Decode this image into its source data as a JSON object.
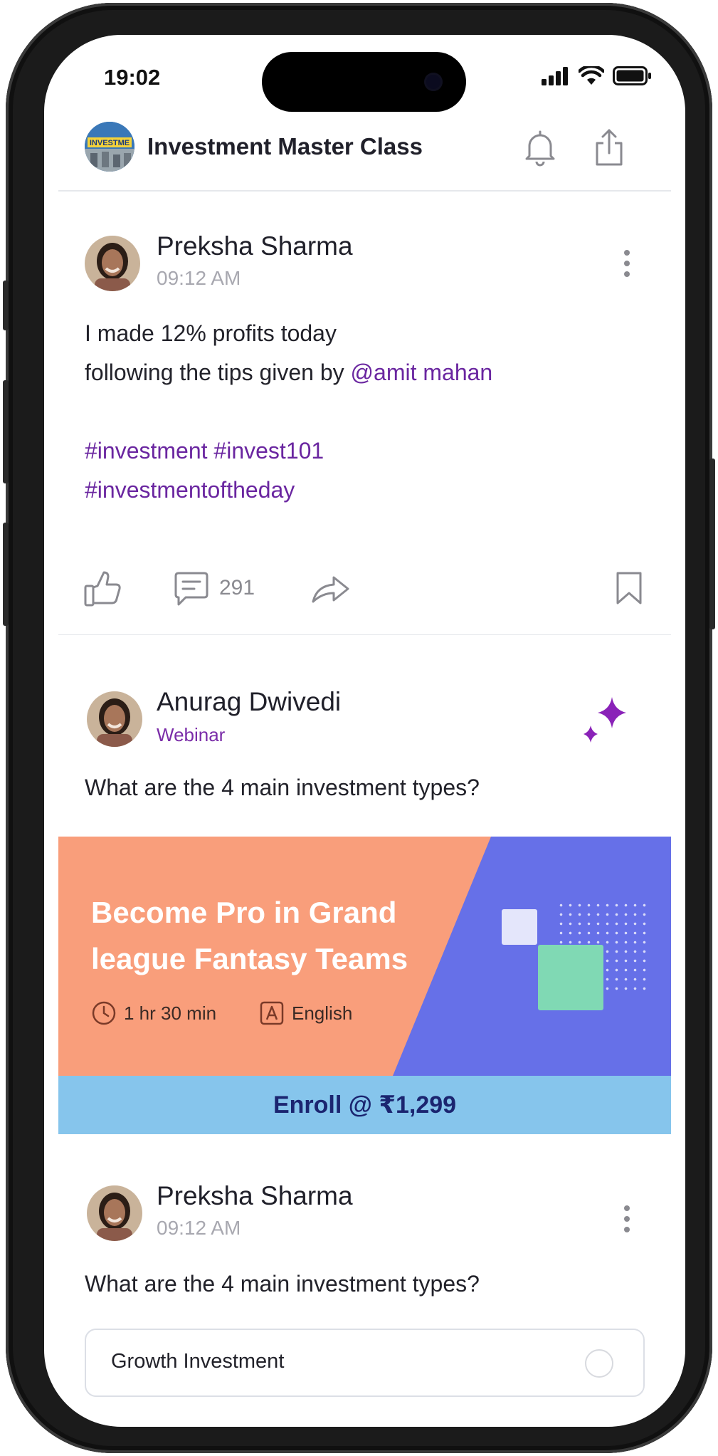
{
  "status_bar": {
    "time": "19:02"
  },
  "header": {
    "community_title": "Investment Master Class",
    "avatar_text": "INVESTME"
  },
  "posts": [
    {
      "author": "Preksha Sharma",
      "time": "09:12 AM",
      "text_line1": "I made 12% profits today",
      "text_line2_prefix": "following the tips given by ",
      "mention": "@amit mahan",
      "hashtags_line1": "#investment #invest101",
      "hashtags_line2": "#investmentoftheday",
      "comment_count": "291"
    },
    {
      "author": "Anurag Dwivedi",
      "tag": "Webinar",
      "question": "What are the 4 main investment types?",
      "banner": {
        "title": "Become Pro in Grand league Fantasy Teams",
        "duration": "1 hr 30 min",
        "language": "English",
        "enroll_label": "Enroll @ ₹1,299"
      }
    },
    {
      "author": "Preksha Sharma",
      "time": "09:12 AM",
      "question": "What are the 4 main investment types?",
      "poll_options": [
        "Growth Investment"
      ]
    }
  ],
  "colors": {
    "accent_purple": "#6a26a0",
    "banner_orange": "#f99e7b",
    "banner_blue": "#6670e8",
    "enroll_bar": "#86c5ec"
  }
}
